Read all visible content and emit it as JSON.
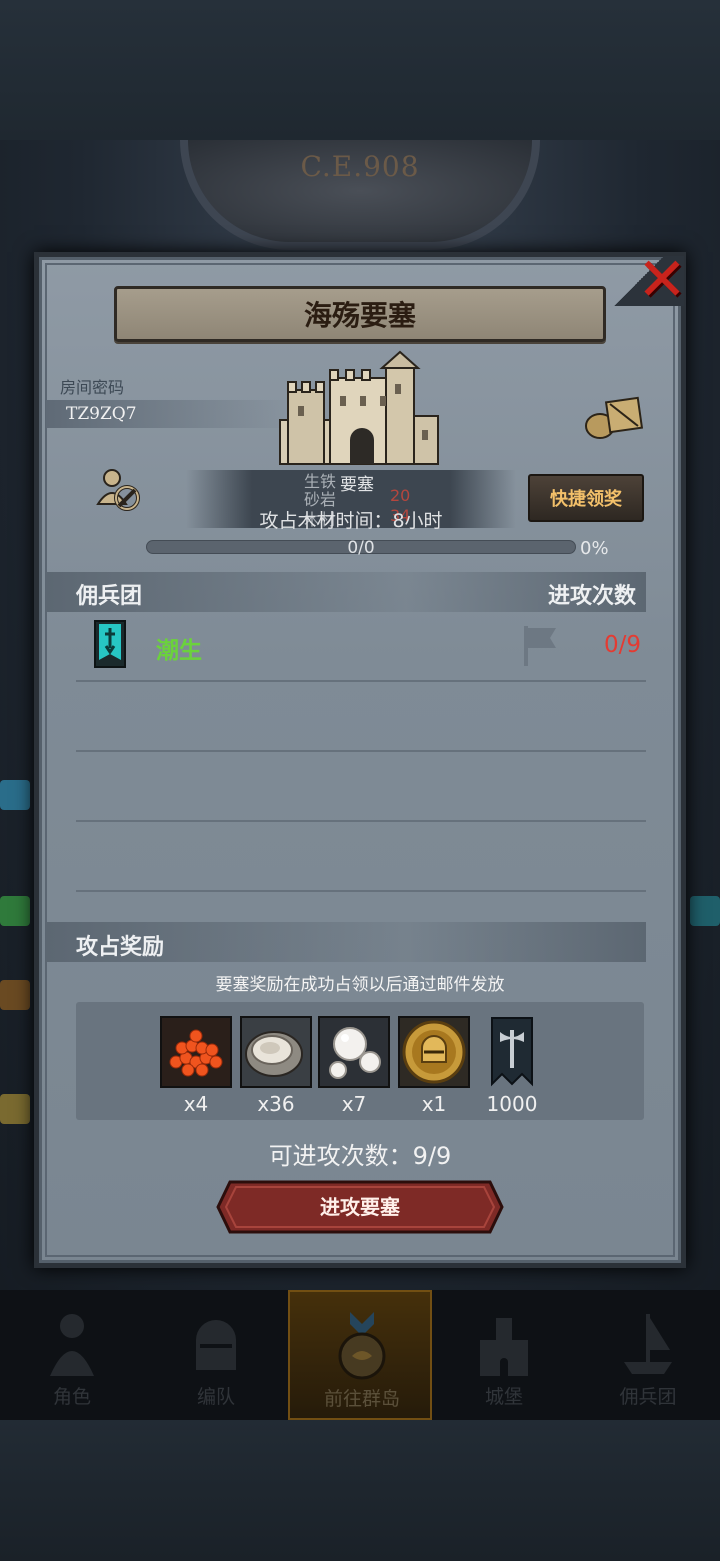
{
  "background": {
    "era_label": "C.E.908"
  },
  "modal": {
    "title": "海殇要塞",
    "room_code_label": "房间密码",
    "room_code": "TZ9ZQ7",
    "quick_claim_label": "快捷领奖",
    "overlay_lines": [
      "生铁",
      "要塞",
      "砂岩",
      "20",
      "木材",
      "34"
    ],
    "capture_time": "攻占木材时间：8小时",
    "progress": {
      "count": "0/0",
      "percent": "0%",
      "fill_fraction": 0
    },
    "mercenary_section": {
      "title": "佣兵团",
      "attacks_header": "进攻次数",
      "rows": [
        {
          "name": "潮生",
          "attacks": "0/9"
        }
      ]
    },
    "rewards_section": {
      "title": "攻占奖励",
      "note": "要塞奖励在成功占领以后通过邮件发放",
      "items": [
        {
          "icon": "roe-icon",
          "qty": "x4"
        },
        {
          "icon": "oyster-icon",
          "qty": "x36"
        },
        {
          "icon": "pearl-icon",
          "qty": "x7"
        },
        {
          "icon": "knight-helmet-coin-icon",
          "qty": "x1"
        },
        {
          "icon": "axe-banner-icon",
          "qty": "1000"
        }
      ]
    },
    "attacks_left": "可进攻次数：9/9",
    "attack_button_label": "进攻要塞"
  },
  "nav": {
    "tabs": [
      {
        "label": "角色",
        "icon": "knight-icon"
      },
      {
        "label": "编队",
        "icon": "formation-helmet-icon"
      },
      {
        "label": "前往群岛",
        "icon": "island-compass-icon",
        "active": true
      },
      {
        "label": "城堡",
        "icon": "castle-icon"
      },
      {
        "label": "佣兵团",
        "icon": "mercenary-ship-icon"
      }
    ]
  },
  "colors": {
    "mercenary_name": "#6bd23c",
    "attacks_count": "#e43b32",
    "quick_claim_text": "#f3c06a",
    "close_x": "#c8231c"
  }
}
